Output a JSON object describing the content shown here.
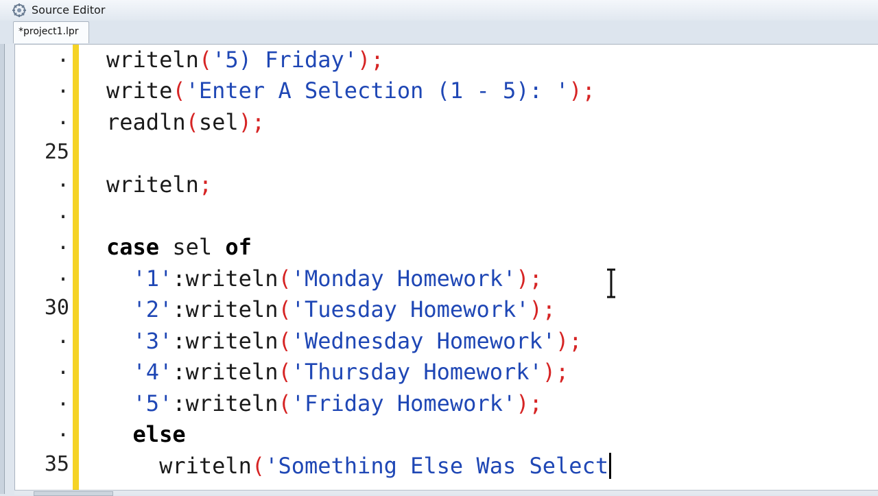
{
  "window": {
    "title": "Source Editor"
  },
  "tabs": [
    {
      "label": "*project1.lpr"
    }
  ],
  "colors": {
    "string": "#1f47b5",
    "symbol": "#d62424",
    "change_bar": "#f5d326"
  },
  "editor": {
    "lines": [
      {
        "number": ".",
        "segments": [
          {
            "text": "writeln",
            "style": "plain"
          },
          {
            "text": "(",
            "style": "sym"
          },
          {
            "text": "'5) Friday'",
            "style": "str"
          },
          {
            "text": ");",
            "style": "sym"
          }
        ]
      },
      {
        "number": ".",
        "segments": [
          {
            "text": "write",
            "style": "plain"
          },
          {
            "text": "(",
            "style": "sym"
          },
          {
            "text": "'Enter A Selection (1 - 5): '",
            "style": "str"
          },
          {
            "text": ");",
            "style": "sym"
          }
        ]
      },
      {
        "number": ".",
        "segments": [
          {
            "text": "readln",
            "style": "plain"
          },
          {
            "text": "(",
            "style": "sym"
          },
          {
            "text": "sel",
            "style": "plain"
          },
          {
            "text": ");",
            "style": "sym"
          }
        ]
      },
      {
        "number": "25",
        "segments": []
      },
      {
        "number": ".",
        "segments": [
          {
            "text": "writeln",
            "style": "plain"
          },
          {
            "text": ";",
            "style": "sym"
          }
        ]
      },
      {
        "number": ".",
        "segments": []
      },
      {
        "number": ".",
        "segments": [
          {
            "text": "case",
            "style": "kw"
          },
          {
            "text": " sel ",
            "style": "plain"
          },
          {
            "text": "of",
            "style": "kw"
          }
        ]
      },
      {
        "number": ".",
        "segments": [
          {
            "text": "  ",
            "style": "plain"
          },
          {
            "text": "'1'",
            "style": "str"
          },
          {
            "text": ":writeln",
            "style": "plain"
          },
          {
            "text": "(",
            "style": "sym"
          },
          {
            "text": "'Monday Homework'",
            "style": "str"
          },
          {
            "text": ");",
            "style": "sym"
          }
        ]
      },
      {
        "number": "30",
        "segments": [
          {
            "text": "  ",
            "style": "plain"
          },
          {
            "text": "'2'",
            "style": "str"
          },
          {
            "text": ":writeln",
            "style": "plain"
          },
          {
            "text": "(",
            "style": "sym"
          },
          {
            "text": "'Tuesday Homework'",
            "style": "str"
          },
          {
            "text": ");",
            "style": "sym"
          }
        ]
      },
      {
        "number": ".",
        "segments": [
          {
            "text": "  ",
            "style": "plain"
          },
          {
            "text": "'3'",
            "style": "str"
          },
          {
            "text": ":writeln",
            "style": "plain"
          },
          {
            "text": "(",
            "style": "sym"
          },
          {
            "text": "'Wednesday Homework'",
            "style": "str"
          },
          {
            "text": ");",
            "style": "sym"
          }
        ]
      },
      {
        "number": ".",
        "segments": [
          {
            "text": "  ",
            "style": "plain"
          },
          {
            "text": "'4'",
            "style": "str"
          },
          {
            "text": ":writeln",
            "style": "plain"
          },
          {
            "text": "(",
            "style": "sym"
          },
          {
            "text": "'Thursday Homework'",
            "style": "str"
          },
          {
            "text": ");",
            "style": "sym"
          }
        ]
      },
      {
        "number": ".",
        "segments": [
          {
            "text": "  ",
            "style": "plain"
          },
          {
            "text": "'5'",
            "style": "str"
          },
          {
            "text": ":writeln",
            "style": "plain"
          },
          {
            "text": "(",
            "style": "sym"
          },
          {
            "text": "'Friday Homework'",
            "style": "str"
          },
          {
            "text": ");",
            "style": "sym"
          }
        ]
      },
      {
        "number": ".",
        "segments": [
          {
            "text": "  ",
            "style": "plain"
          },
          {
            "text": "else",
            "style": "kw"
          }
        ]
      },
      {
        "number": "35",
        "caret": true,
        "segments": [
          {
            "text": "    writeln",
            "style": "plain"
          },
          {
            "text": "(",
            "style": "sym"
          },
          {
            "text": "'Something Else Was Select",
            "style": "str"
          }
        ]
      }
    ]
  }
}
